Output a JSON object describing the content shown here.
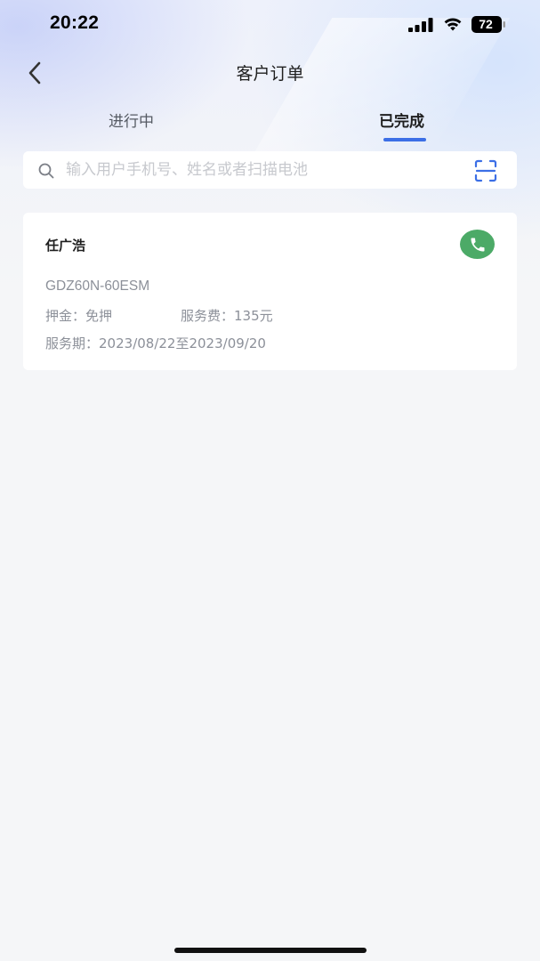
{
  "status_bar": {
    "time": "20:22",
    "battery_level": "72"
  },
  "nav": {
    "title": "客户订单",
    "back_icon": "chevron-left-icon"
  },
  "tabs": [
    {
      "label": "进行中",
      "active": false
    },
    {
      "label": "已完成",
      "active": true
    }
  ],
  "search": {
    "placeholder": "输入用户手机号、姓名或者扫描电池",
    "value": "",
    "scan_icon": "scan-icon"
  },
  "orders": [
    {
      "customer_name": "任广浩",
      "model": "GDZ60N-60ESM",
      "deposit_label": "押金：",
      "deposit_value": "免押",
      "fee_label": "服务费：",
      "fee_value": "135元",
      "period_label": "服务期：",
      "period_value": "2023/08/22至2023/09/20",
      "call_icon": "phone-icon"
    }
  ],
  "colors": {
    "accent": "#3c6fe6",
    "call_button": "#4caa67",
    "secondary_text": "#8c9099"
  }
}
